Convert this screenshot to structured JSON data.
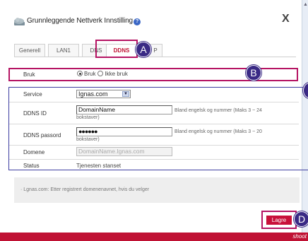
{
  "window": {
    "title": "Grunnleggende Nettverk Innstilling",
    "close_label": "X"
  },
  "tabs": [
    {
      "label": "Generell"
    },
    {
      "label": "LAN1"
    },
    {
      "label": "DNS"
    },
    {
      "label": "DDNS",
      "active": true
    },
    {
      "label": "P"
    }
  ],
  "callouts": {
    "a": "A",
    "b": "B",
    "d": "D"
  },
  "bruk": {
    "label": "Bruk",
    "option_on": "Bruk",
    "option_off": "Ikke bruk",
    "selected": "Bruk"
  },
  "service": {
    "label": "Service",
    "value": "Ignas.com"
  },
  "ddns_id": {
    "label": "DDNS ID",
    "value": "DomainName",
    "hint": "Bland engelsk og nummer (Maks 3 ~ 24",
    "hint_cont": "bokstaver)"
  },
  "ddns_password": {
    "label": "DDNS passord",
    "value": "●●●●●●",
    "hint": "Bland engelsk og nummer (Maks 3 ~ 20",
    "hint_cont": "bokstaver)"
  },
  "domene": {
    "label": "Domene",
    "placeholder": "DomainName.Ignas.com"
  },
  "status": {
    "label": "Status",
    "value": "Tjenesten stanset"
  },
  "info": "· Lgnas.com: Etter registrert domenenavnet, hvis du velger",
  "save_label": "Lagre",
  "brand": "shoot",
  "colors": {
    "accent": "#c01234",
    "callout": "#3a2a85",
    "frame_pink": "#b51463",
    "frame_blue": "#3c3ca0"
  }
}
